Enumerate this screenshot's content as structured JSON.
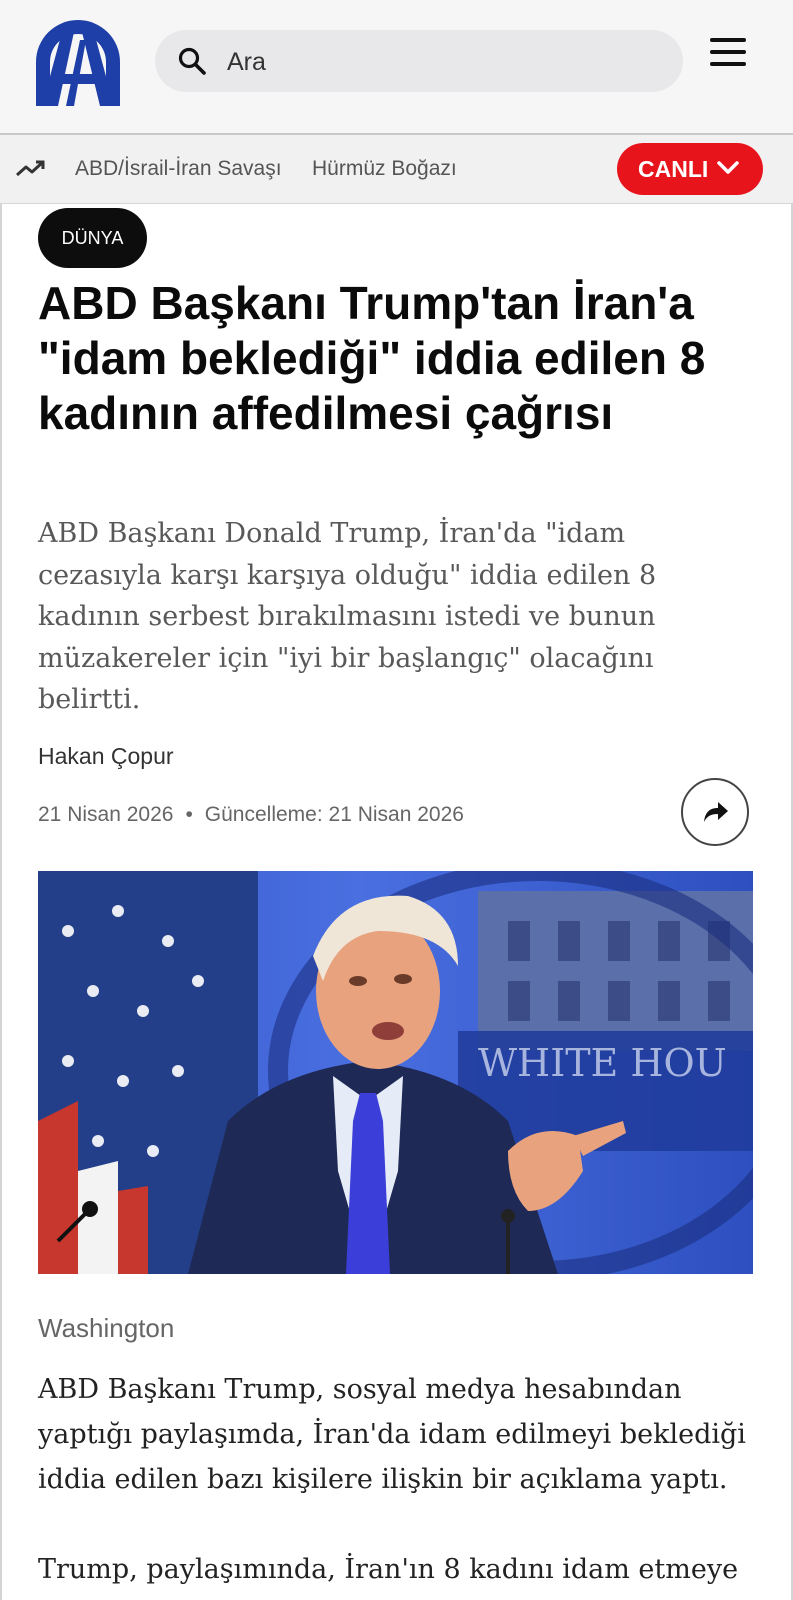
{
  "header": {
    "logo_text": "AA",
    "search_placeholder": "Ara",
    "brand_color": "#1e3fa8"
  },
  "trending": {
    "items": [
      "ABD/İsrail-İran Savaşı",
      "Hürmüz Boğazı"
    ],
    "live_label": "CANLI",
    "live_color": "#e8141c"
  },
  "article": {
    "category": "DÜNYA",
    "headline": "ABD Başkanı Trump'tan İran'a \"idam beklediği\" iddia edilen 8 kadının affedilmesi çağrısı",
    "summary": "ABD Başkanı Donald Trump, İran'da \"idam cezasıyla karşı karşıya olduğu\" iddia edilen 8 kadının serbest bırakılmasını istedi ve bunun müzakereler için \"iyi bir başlangıç\" olacağını belirtti.",
    "author": "Hakan Çopur",
    "date": "21 Nisan 2026",
    "updated": "Güncelleme: 21 Nisan 2026",
    "dateline": "Washington",
    "paragraphs": [
      "ABD Başkanı Trump, sosyal medya hesabından yaptığı paylaşımda, İran'da idam edilmeyi beklediği iddia edilen bazı kişilere ilişkin bir açıklama yaptı.",
      "Trump, paylaşımında, İran'ın 8 kadını idam etmeye"
    ]
  }
}
